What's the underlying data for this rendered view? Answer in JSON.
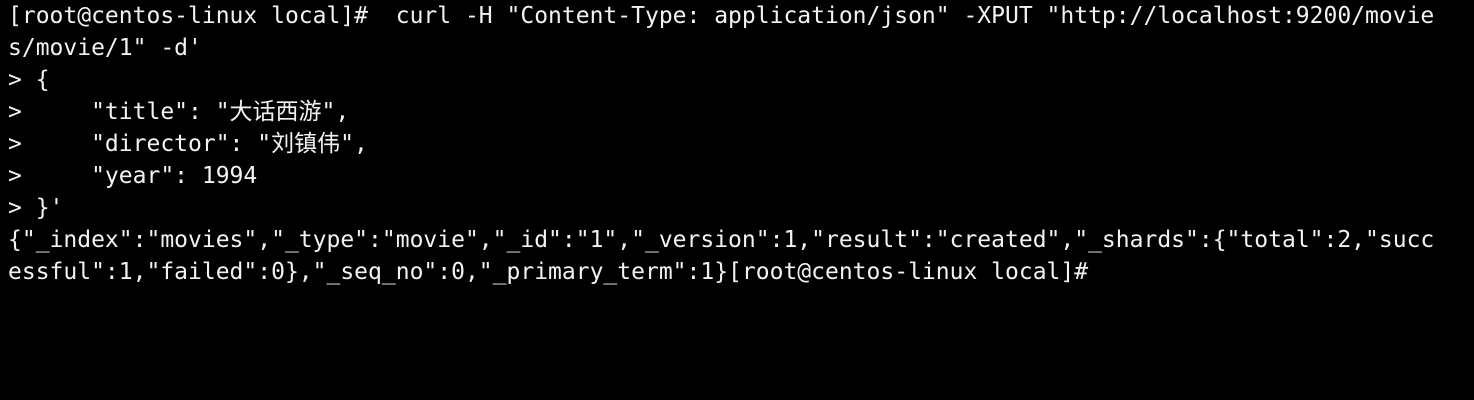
{
  "colors": {
    "background": "#000000",
    "foreground": "#f2f2f2"
  },
  "terminal": {
    "lines": [
      "[root@centos-linux local]#  curl -H \"Content-Type: application/json\" -XPUT \"http://localhost:9200/movie",
      "s/movie/1\" -d'",
      "> {",
      ">     \"title\": \"大话西游\",",
      ">     \"director\": \"刘镇伟\",",
      ">     \"year\": 1994",
      "> }'",
      "{\"_index\":\"movies\",\"_type\":\"movie\",\"_id\":\"1\",\"_version\":1,\"result\":\"created\",\"_shards\":{\"total\":2,\"succ",
      "essful\":1,\"failed\":0},\"_seq_no\":0,\"_primary_term\":1}[root@centos-linux local]#"
    ]
  }
}
